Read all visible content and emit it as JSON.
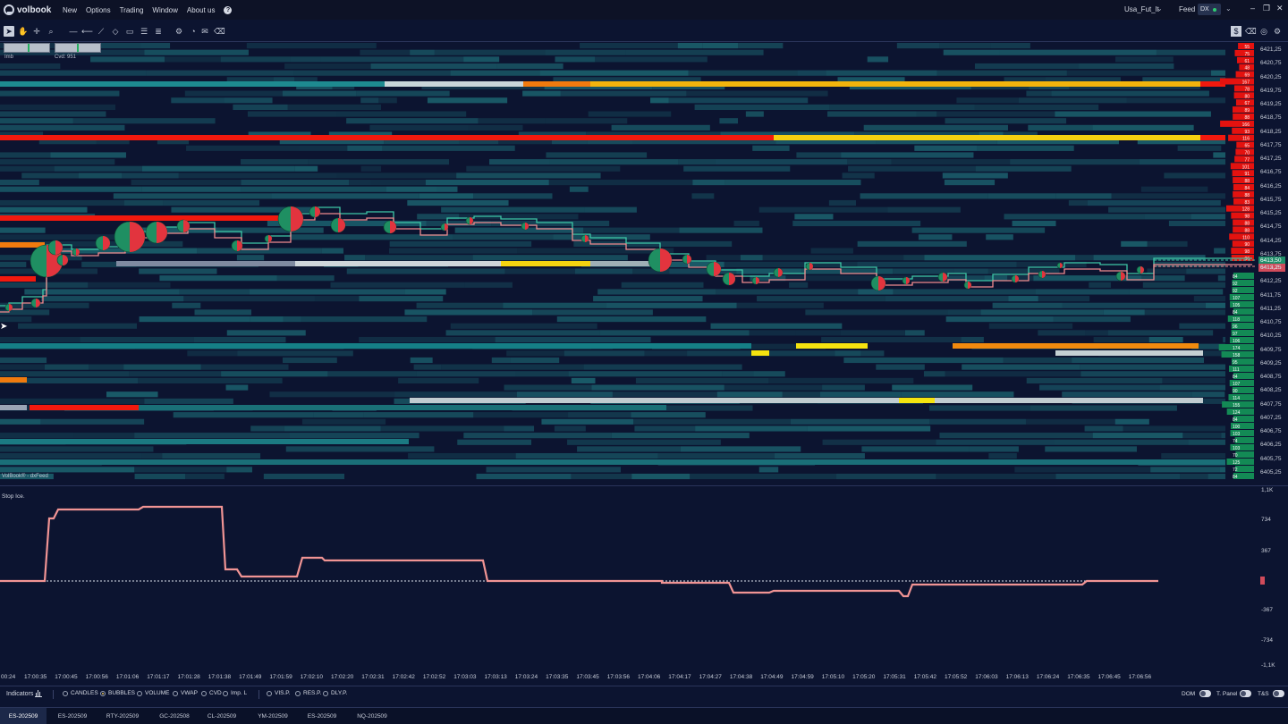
{
  "app": {
    "name": "volbook"
  },
  "menu": [
    "New",
    "Options",
    "Trading",
    "Window",
    "About us"
  ],
  "profile": "Usa_Fut_lt",
  "feed": {
    "label": "Feed",
    "value": "DX"
  },
  "window_controls": [
    "minimize-icon",
    "restore-icon",
    "close-icon"
  ],
  "toolbar": {
    "left_icons": [
      "pointer-icon",
      "hand-icon",
      "crosshair-icon",
      "zoom-icon",
      "horizontal-line-icon",
      "ray-icon",
      "trend-line-icon",
      "measure-icon",
      "rectangle-icon",
      "list-icon",
      "menu-icon",
      "settings-icon",
      "bucket-icon",
      "note-icon",
      "eraser-icon"
    ],
    "right_icons": [
      "dollar-icon",
      "eraser-icon",
      "target-icon",
      "gear-icon"
    ]
  },
  "mini_panels": {
    "imb_label": "Imb",
    "cvd_label": "Cvd: 951"
  },
  "footer_credit": "VolBook® - dxFeed",
  "indicator_panel": {
    "title": "Stop Ice.",
    "axis": [
      "1,1K",
      "734",
      "367",
      "-367",
      "-734",
      "-1,1K"
    ]
  },
  "colors": {
    "background": "#0c1430",
    "heat_low": "#1d6a75",
    "heat_high": "#f7e71c",
    "hot": "#f2190e",
    "bid_bar": "#138a55",
    "ask_bar": "#e4120f",
    "line_bid": "#3ec7a6",
    "line_ask": "#f08a8e",
    "indicator_line": "#f19494"
  },
  "price_axis": {
    "labels": [
      "6421,25",
      "6420,75",
      "6420,25",
      "6419,75",
      "6419,25",
      "6418,75",
      "6418,25",
      "6417,75",
      "6417,25",
      "6416,75",
      "6416,25",
      "6415,75",
      "6415,25",
      "6414,75",
      "6414,25",
      "6413,75",
      "6412,75",
      "6412,25",
      "6411,75",
      "6411,25",
      "6410,75",
      "6410,25",
      "6409,75",
      "6409,25",
      "6408,75",
      "6408,25",
      "6407,75",
      "6407,25",
      "6406,75",
      "6406,25",
      "6405,75",
      "6405,25"
    ],
    "bid_tag": "6413,50",
    "ask_tag": "6413,25"
  },
  "dom_sizes": {
    "ask": [
      "55",
      "75",
      "61",
      "48",
      "69",
      "167",
      "78",
      "80",
      "67",
      "89",
      "88",
      "166",
      "93",
      "116",
      "65",
      "70",
      "77",
      "101",
      "91",
      "88",
      "84",
      "88",
      "83",
      "128",
      "98",
      "88",
      "88",
      "110",
      "90",
      "98",
      "96"
    ],
    "bid": [
      "84",
      "92",
      "92",
      "107",
      "105",
      "84",
      "118",
      "96",
      "97",
      "106",
      "174",
      "158",
      "95",
      "111",
      "84",
      "107",
      "90",
      "114",
      "155",
      "124",
      "84",
      "100",
      "103",
      "74",
      "103",
      "70",
      "125",
      "72",
      "84"
    ]
  },
  "time_axis": [
    "00:24",
    "17:00:35",
    "17:00:45",
    "17:00:56",
    "17:01:06",
    "17:01:17",
    "17:01:28",
    "17:01:38",
    "17:01:49",
    "17:01:59",
    "17:02:10",
    "17:02:20",
    "17:02:31",
    "17:02:42",
    "17:02:52",
    "17:03:03",
    "17:03:13",
    "17:03:24",
    "17:03:35",
    "17:03:45",
    "17:03:56",
    "17:04:06",
    "17:04:17",
    "17:04:27",
    "17:04:38",
    "17:04:49",
    "17:04:59",
    "17:05:10",
    "17:05:20",
    "17:05:31",
    "17:05:42",
    "17:05:52",
    "17:06:03",
    "17:06:13",
    "17:06:24",
    "17:06:35",
    "17:06:45",
    "17:06:56"
  ],
  "indicators_bar": {
    "button": "Indicators",
    "options": [
      {
        "label": "CANDLES",
        "on": false
      },
      {
        "label": "BUBBLES",
        "on": true
      },
      {
        "label": "VOLUME",
        "on": false
      },
      {
        "label": "VWAP",
        "on": false
      },
      {
        "label": "CVD",
        "on": false
      },
      {
        "label": "Imp. L",
        "on": false
      }
    ],
    "options2": [
      {
        "label": "VIS.P.",
        "on": false
      },
      {
        "label": "RES.P.",
        "on": false
      },
      {
        "label": "DLY.P.",
        "on": false
      }
    ],
    "toggles": [
      "DOM",
      "T. Panel",
      "T&S"
    ]
  },
  "tabs": [
    {
      "label": "ES-202509",
      "active": true
    },
    {
      "label": "ES-202509",
      "active": false
    },
    {
      "label": "RTY-202509",
      "active": false
    },
    {
      "label": "GC-202508",
      "active": false
    },
    {
      "label": "CL-202509",
      "active": false
    },
    {
      "label": "YM-202509",
      "active": false
    },
    {
      "label": "ES-202509",
      "active": false
    },
    {
      "label": "NQ-202509",
      "active": false
    }
  ]
}
